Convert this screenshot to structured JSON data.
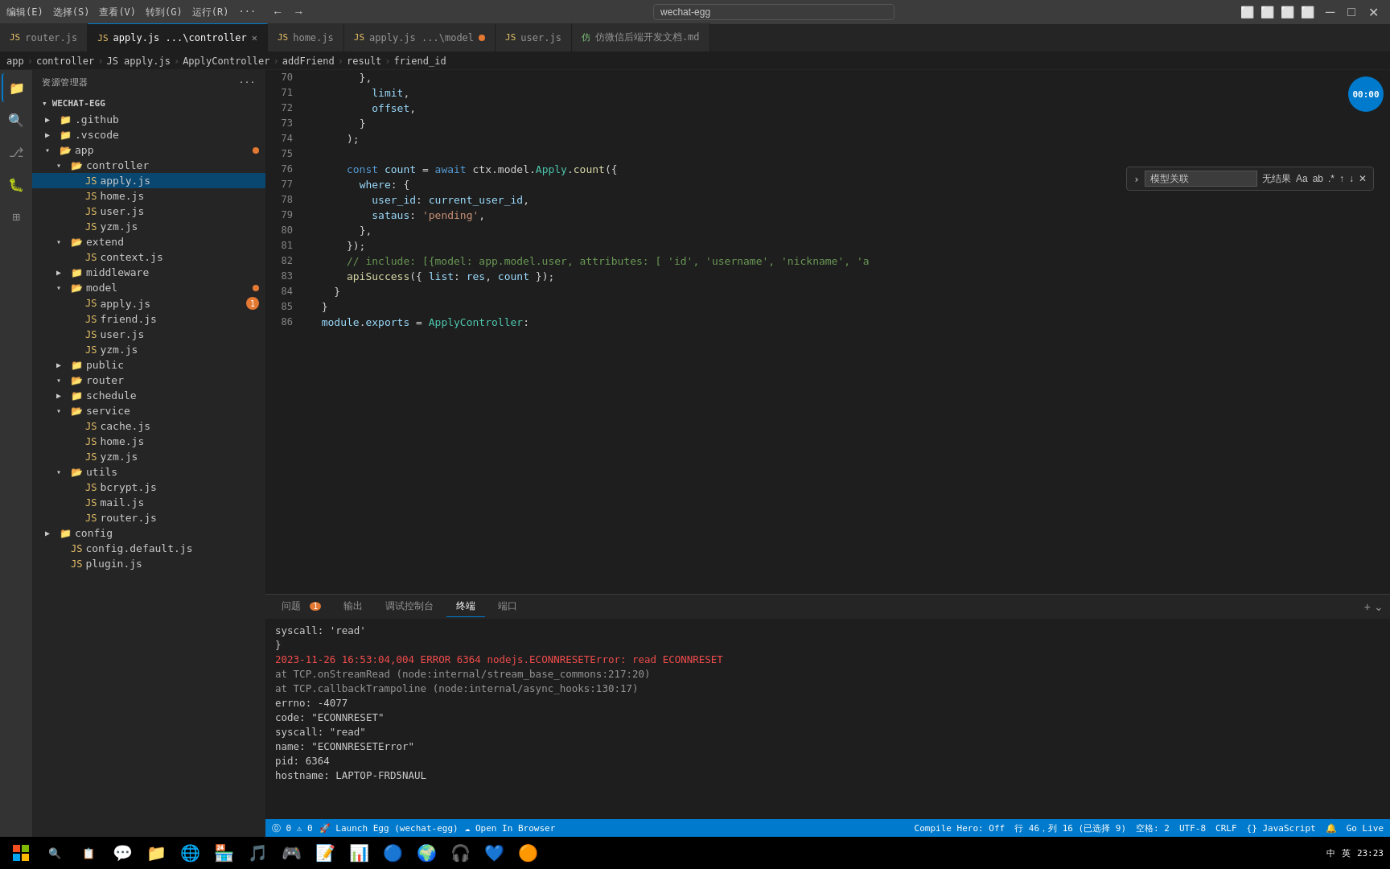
{
  "titlebar": {
    "menus": [
      "编辑(E)",
      "选择(S)",
      "查看(V)",
      "转到(G)",
      "运行(R)",
      "···"
    ],
    "search_placeholder": "wechat-egg",
    "window_controls": [
      "─",
      "□",
      "✕"
    ]
  },
  "tabs": [
    {
      "id": "router",
      "label": "router.js",
      "icon": "JS",
      "active": false,
      "modified": false,
      "closeable": false
    },
    {
      "id": "apply_controller",
      "label": "apply.js ...\\controller",
      "icon": "JS",
      "active": true,
      "modified": false,
      "closeable": true
    },
    {
      "id": "home",
      "label": "home.js",
      "icon": "JS",
      "active": false,
      "modified": false,
      "closeable": false
    },
    {
      "id": "apply_model",
      "label": "apply.js ...\\model",
      "icon": "JS",
      "active": false,
      "modified": false,
      "closeable": false
    },
    {
      "id": "user",
      "label": "user.js",
      "icon": "JS",
      "active": false,
      "modified": false,
      "closeable": false
    },
    {
      "id": "docs",
      "label": "仿微信后端开发文档.md",
      "icon": "MD",
      "active": false,
      "modified": false,
      "closeable": false
    }
  ],
  "breadcrumb": {
    "parts": [
      "app",
      ">",
      "controller",
      ">",
      "JS apply.js",
      ">",
      "ApplyController",
      ">",
      "addFriend",
      ">",
      "result",
      ">",
      "friend_id"
    ]
  },
  "find_widget": {
    "placeholder": "模型关联",
    "result": "无结果",
    "buttons": [
      "Aa",
      "ab",
      "*"
    ]
  },
  "code": {
    "lines": [
      {
        "num": 70,
        "tokens": [
          {
            "t": "        },{",
            "c": "punc"
          }
        ]
      },
      {
        "num": 71,
        "tokens": [
          {
            "t": "          limit,",
            "c": "prop"
          }
        ]
      },
      {
        "num": 72,
        "tokens": [
          {
            "t": "          offset,",
            "c": "prop"
          }
        ]
      },
      {
        "num": 73,
        "tokens": [
          {
            "t": "        }",
            "c": "punc"
          }
        ]
      },
      {
        "num": 74,
        "tokens": [
          {
            "t": "      );",
            "c": "punc"
          }
        ]
      },
      {
        "num": 75,
        "tokens": []
      },
      {
        "num": 76,
        "tokens": [
          {
            "t": "      ",
            "c": "op"
          },
          {
            "t": "const",
            "c": "kw"
          },
          {
            "t": " ",
            "c": "op"
          },
          {
            "t": "count",
            "c": "var"
          },
          {
            "t": " = ",
            "c": "op"
          },
          {
            "t": "await",
            "c": "kw"
          },
          {
            "t": " ctx.model.",
            "c": "op"
          },
          {
            "t": "Apply",
            "c": "cls"
          },
          {
            "t": ".",
            "c": "op"
          },
          {
            "t": "count",
            "c": "fn"
          },
          {
            "t": "({",
            "c": "punc"
          }
        ]
      },
      {
        "num": 77,
        "tokens": [
          {
            "t": "        ",
            "c": "op"
          },
          {
            "t": "where",
            "c": "prop"
          },
          {
            "t": ": {",
            "c": "punc"
          }
        ]
      },
      {
        "num": 78,
        "tokens": [
          {
            "t": "          ",
            "c": "op"
          },
          {
            "t": "user_id",
            "c": "prop"
          },
          {
            "t": ": ",
            "c": "op"
          },
          {
            "t": "current_user_id",
            "c": "var"
          },
          {
            "t": ",",
            "c": "punc"
          }
        ]
      },
      {
        "num": 79,
        "tokens": [
          {
            "t": "          ",
            "c": "op"
          },
          {
            "t": "sataus",
            "c": "prop"
          },
          {
            "t": ": ",
            "c": "op"
          },
          {
            "t": "'pending'",
            "c": "str"
          },
          {
            "t": ",",
            "c": "punc"
          }
        ]
      },
      {
        "num": 80,
        "tokens": [
          {
            "t": "        },",
            "c": "punc"
          }
        ]
      },
      {
        "num": 81,
        "tokens": [
          {
            "t": "      });",
            "c": "punc"
          }
        ]
      },
      {
        "num": 82,
        "tokens": [
          {
            "t": "      ",
            "c": "op"
          },
          {
            "t": "// include: [{model: app.model.user, attributes: [ 'id', 'username', 'nickname', 'a",
            "c": "comment"
          }
        ]
      },
      {
        "num": 83,
        "tokens": [
          {
            "t": "      ",
            "c": "op"
          },
          {
            "t": "apiSuccess",
            "c": "fn"
          },
          {
            "t": "({ ",
            "c": "punc"
          },
          {
            "t": "list",
            "c": "prop"
          },
          {
            "t": ": ",
            "c": "op"
          },
          {
            "t": "res",
            "c": "var"
          },
          {
            "t": ", ",
            "c": "op"
          },
          {
            "t": "count",
            "c": "var"
          },
          {
            "t": " });",
            "c": "punc"
          }
        ]
      },
      {
        "num": 84,
        "tokens": [
          {
            "t": "    }",
            "c": "punc"
          }
        ]
      },
      {
        "num": 85,
        "tokens": [
          {
            "t": "  }",
            "c": "punc"
          }
        ]
      },
      {
        "num": 86,
        "tokens": [
          {
            "t": "  ",
            "c": "op"
          },
          {
            "t": "module",
            "c": "var"
          },
          {
            "t": ".",
            "c": "op"
          },
          {
            "t": "exports",
            "c": "prop"
          },
          {
            "t": " = ",
            "c": "op"
          },
          {
            "t": "ApplyController",
            "c": "cls"
          },
          {
            "t": ":",
            "c": "punc"
          }
        ]
      }
    ]
  },
  "file_tree": {
    "project": "WECHAT-EGG",
    "items": [
      {
        "name": ".github",
        "type": "folder",
        "level": 1,
        "expanded": false
      },
      {
        "name": ".vscode",
        "type": "folder",
        "level": 1,
        "expanded": false
      },
      {
        "name": "app",
        "type": "folder",
        "level": 1,
        "expanded": true,
        "dotbadge": true
      },
      {
        "name": "controller",
        "type": "folder",
        "level": 2,
        "expanded": true
      },
      {
        "name": "apply.js",
        "type": "js",
        "level": 3,
        "active": true
      },
      {
        "name": "home.js",
        "type": "js",
        "level": 3
      },
      {
        "name": "user.js",
        "type": "js",
        "level": 3
      },
      {
        "name": "yzm.js",
        "type": "js",
        "level": 3
      },
      {
        "name": "extend",
        "type": "folder",
        "level": 2,
        "expanded": true
      },
      {
        "name": "context.js",
        "type": "js",
        "level": 3
      },
      {
        "name": "middleware",
        "type": "folder",
        "level": 2,
        "expanded": false
      },
      {
        "name": "model",
        "type": "folder",
        "level": 2,
        "expanded": true,
        "dotbadge": true
      },
      {
        "name": "apply.js",
        "type": "js",
        "level": 3,
        "badge": "1"
      },
      {
        "name": "friend.js",
        "type": "js",
        "level": 3
      },
      {
        "name": "user.js",
        "type": "js",
        "level": 3
      },
      {
        "name": "yzm.js",
        "type": "js",
        "level": 3
      },
      {
        "name": "public",
        "type": "folder",
        "level": 2,
        "expanded": false
      },
      {
        "name": "router",
        "type": "folder",
        "level": 2,
        "expanded": true
      },
      {
        "name": "schedule",
        "type": "folder",
        "level": 2,
        "expanded": false
      },
      {
        "name": "service",
        "type": "folder",
        "level": 2,
        "expanded": true
      },
      {
        "name": "cache.js",
        "type": "js",
        "level": 3
      },
      {
        "name": "home.js",
        "type": "js",
        "level": 3
      },
      {
        "name": "yzm.js",
        "type": "js",
        "level": 3
      },
      {
        "name": "utils",
        "type": "folder",
        "level": 2,
        "expanded": true
      },
      {
        "name": "bcrypt.js",
        "type": "js",
        "level": 3
      },
      {
        "name": "mail.js",
        "type": "js",
        "level": 3
      },
      {
        "name": "router.js",
        "type": "js",
        "level": 3
      },
      {
        "name": "config",
        "type": "folder",
        "level": 1,
        "expanded": false
      },
      {
        "name": "config.default.js",
        "type": "js",
        "level": 2
      },
      {
        "name": "plugin.js",
        "type": "js",
        "level": 2
      }
    ]
  },
  "panel": {
    "tabs": [
      {
        "label": "问题",
        "badge": "1"
      },
      {
        "label": "输出"
      },
      {
        "label": "调试控制台"
      },
      {
        "label": "终端",
        "active": true
      },
      {
        "label": "端口"
      }
    ]
  },
  "terminal": {
    "lines": [
      {
        "text": "    syscall: 'read'",
        "color": "normal"
      },
      {
        "text": "  }",
        "color": "normal"
      },
      {
        "text": "2023-11-26 16:53:04,004 ERROR 6364 nodejs.ECONNRESETError: read ECONNRESET",
        "color": "red"
      },
      {
        "text": "    at TCP.onStreamRead (node:internal/stream_base_commons:217:20)",
        "color": "dim"
      },
      {
        "text": "    at TCP.callbackTrampoline (node:internal/async_hooks:130:17)",
        "color": "dim"
      },
      {
        "text": "  errno: -4077",
        "color": "normal"
      },
      {
        "text": "  code: \"ECONNRESET\"",
        "color": "normal"
      },
      {
        "text": "  syscall: \"read\"",
        "color": "normal"
      },
      {
        "text": "  name: \"ECONNRESETError\"",
        "color": "normal"
      },
      {
        "text": "  pid: 6364",
        "color": "normal"
      },
      {
        "text": "  hostname: LAPTOP-FRD5NAUL",
        "color": "normal"
      }
    ]
  },
  "statusbar": {
    "left": [
      {
        "label": "⓪ 0"
      },
      {
        "label": "⚠ 0"
      },
      {
        "label": "🚀 Launch Egg (wechat-egg)"
      },
      {
        "label": "☁ Open In Browser"
      }
    ],
    "right": [
      {
        "label": "Compile Hero: Off"
      },
      {
        "label": "行 46，列 16 (已选择 9)"
      },
      {
        "label": "空格: 2"
      },
      {
        "label": "UTF-8"
      },
      {
        "label": "CRLF"
      },
      {
        "label": "{} JavaScript"
      },
      {
        "label": "🔔"
      },
      {
        "label": "Go Live"
      }
    ]
  },
  "timer": {
    "label": "00:00"
  },
  "taskbar": {
    "right_time": "23:23",
    "right_date": ""
  }
}
